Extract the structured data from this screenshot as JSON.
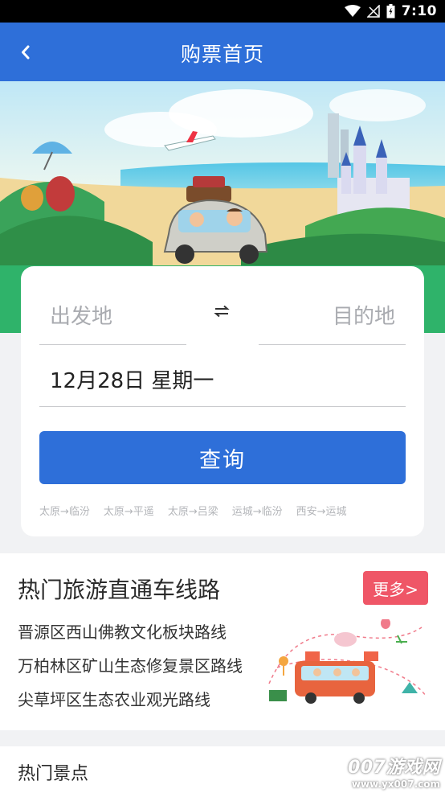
{
  "status_bar": {
    "time": "7:10"
  },
  "header": {
    "title": "购票首页"
  },
  "search": {
    "from_placeholder": "出发地",
    "to_placeholder": "目的地",
    "date": "12月28日 星期一",
    "query_label": "查询",
    "history": [
      "太原→临汾",
      "太原→平遥",
      "太原→吕梁",
      "运城→临汾",
      "西安→运城"
    ]
  },
  "hot_routes": {
    "title": "热门旅游直通车线路",
    "more_label": "更多>",
    "items": [
      "晋源区西山佛教文化板块路线",
      "万柏林区矿山生态修复景区路线",
      "尖草坪区生态农业观光路线"
    ]
  },
  "hot_spots": {
    "title": "热门景点"
  },
  "watermark": {
    "brand": "007游戏网",
    "url": "www.yx007.com"
  },
  "colors": {
    "primary": "#2e6fd9",
    "accent_red": "#ef5667",
    "band_green": "#2fb36a"
  }
}
